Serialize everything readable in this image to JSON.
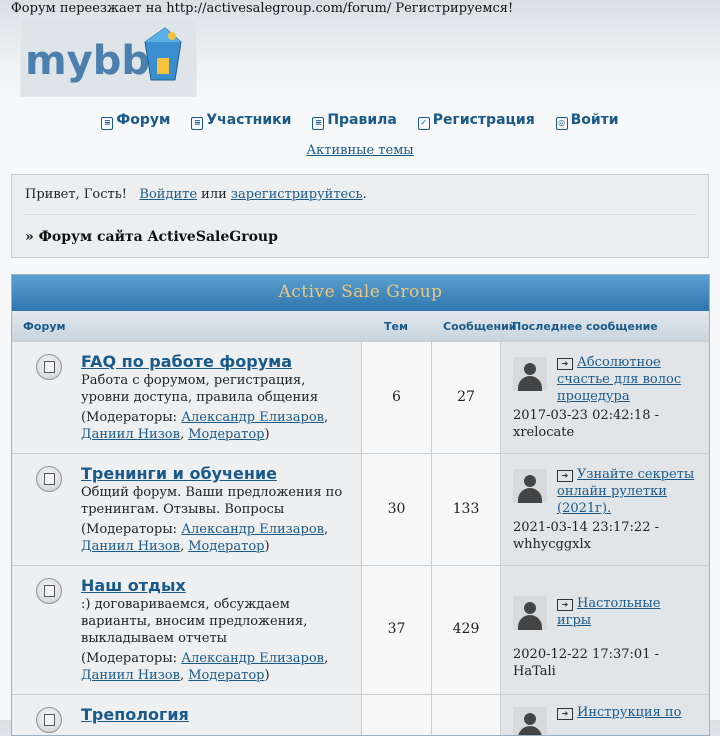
{
  "announcement": "Форум переезжает на http://activesalegroup.com/forum/ Регистрируемся!",
  "logo_text": "mybb",
  "nav": {
    "items": [
      {
        "label": "Форум",
        "icon": "forum-icon"
      },
      {
        "label": "Участники",
        "icon": "members-icon"
      },
      {
        "label": "Правила",
        "icon": "rules-icon"
      },
      {
        "label": "Регистрация",
        "icon": "register-icon"
      },
      {
        "label": "Войти",
        "icon": "login-icon"
      }
    ],
    "active_topics": "Активные темы"
  },
  "welcome": {
    "greeting": "Привет, Гость!",
    "login_link": "Войдите",
    "or": "или",
    "register_link": "зарегистрируйтесь",
    "period": ".",
    "breadcrumb": "» Форум сайта ActiveSaleGroup"
  },
  "board": {
    "title": "Active Sale Group",
    "columns": [
      "Форум",
      "Тем",
      "Сообщений",
      "Последнее сообщение"
    ],
    "moderators_label": "(Модераторы:",
    "forums": [
      {
        "title": "FAQ по работе форума",
        "description": "Работа с форумом, регистрация, уровни доступа, правила общения",
        "moderators": [
          "Александр Елизаров",
          "Даниил Низов",
          "Модератор"
        ],
        "topics": "6",
        "posts": "27",
        "last_post_title": "Абсолютное счастье для волос процедура",
        "last_post_meta": "2017-03-23 02:42:18 - xrelocate"
      },
      {
        "title": "Тренинги и обучение",
        "description": "Общий форум. Ваши предложения по тренингам. Отзывы. Вопросы",
        "moderators": [
          "Александр Елизаров",
          "Даниил Низов",
          "Модератор"
        ],
        "topics": "30",
        "posts": "133",
        "last_post_title": "Узнайте секреты онлайн рулетки (2021г).",
        "last_post_meta": "2021-03-14 23:17:22 - whhycggxlx"
      },
      {
        "title": "Наш отдых",
        "description": ":) договариваемся, обсуждаем варианты, вносим предложения, выкладываем отчеты",
        "moderators": [
          "Александр Елизаров",
          "Даниил Низов",
          "Модератор"
        ],
        "topics": "37",
        "posts": "429",
        "last_post_title": "Настольные игры",
        "last_post_meta": "2020-12-22 17:37:01 - HaTali"
      },
      {
        "title": "Трепология",
        "description": "",
        "moderators": [],
        "topics": "",
        "posts": "",
        "last_post_title": "Инструкция по",
        "last_post_meta": ""
      }
    ]
  },
  "colors": {
    "link": "#1a5a8a",
    "board_header": "#2f76ad",
    "board_title": "#f0c77a"
  }
}
